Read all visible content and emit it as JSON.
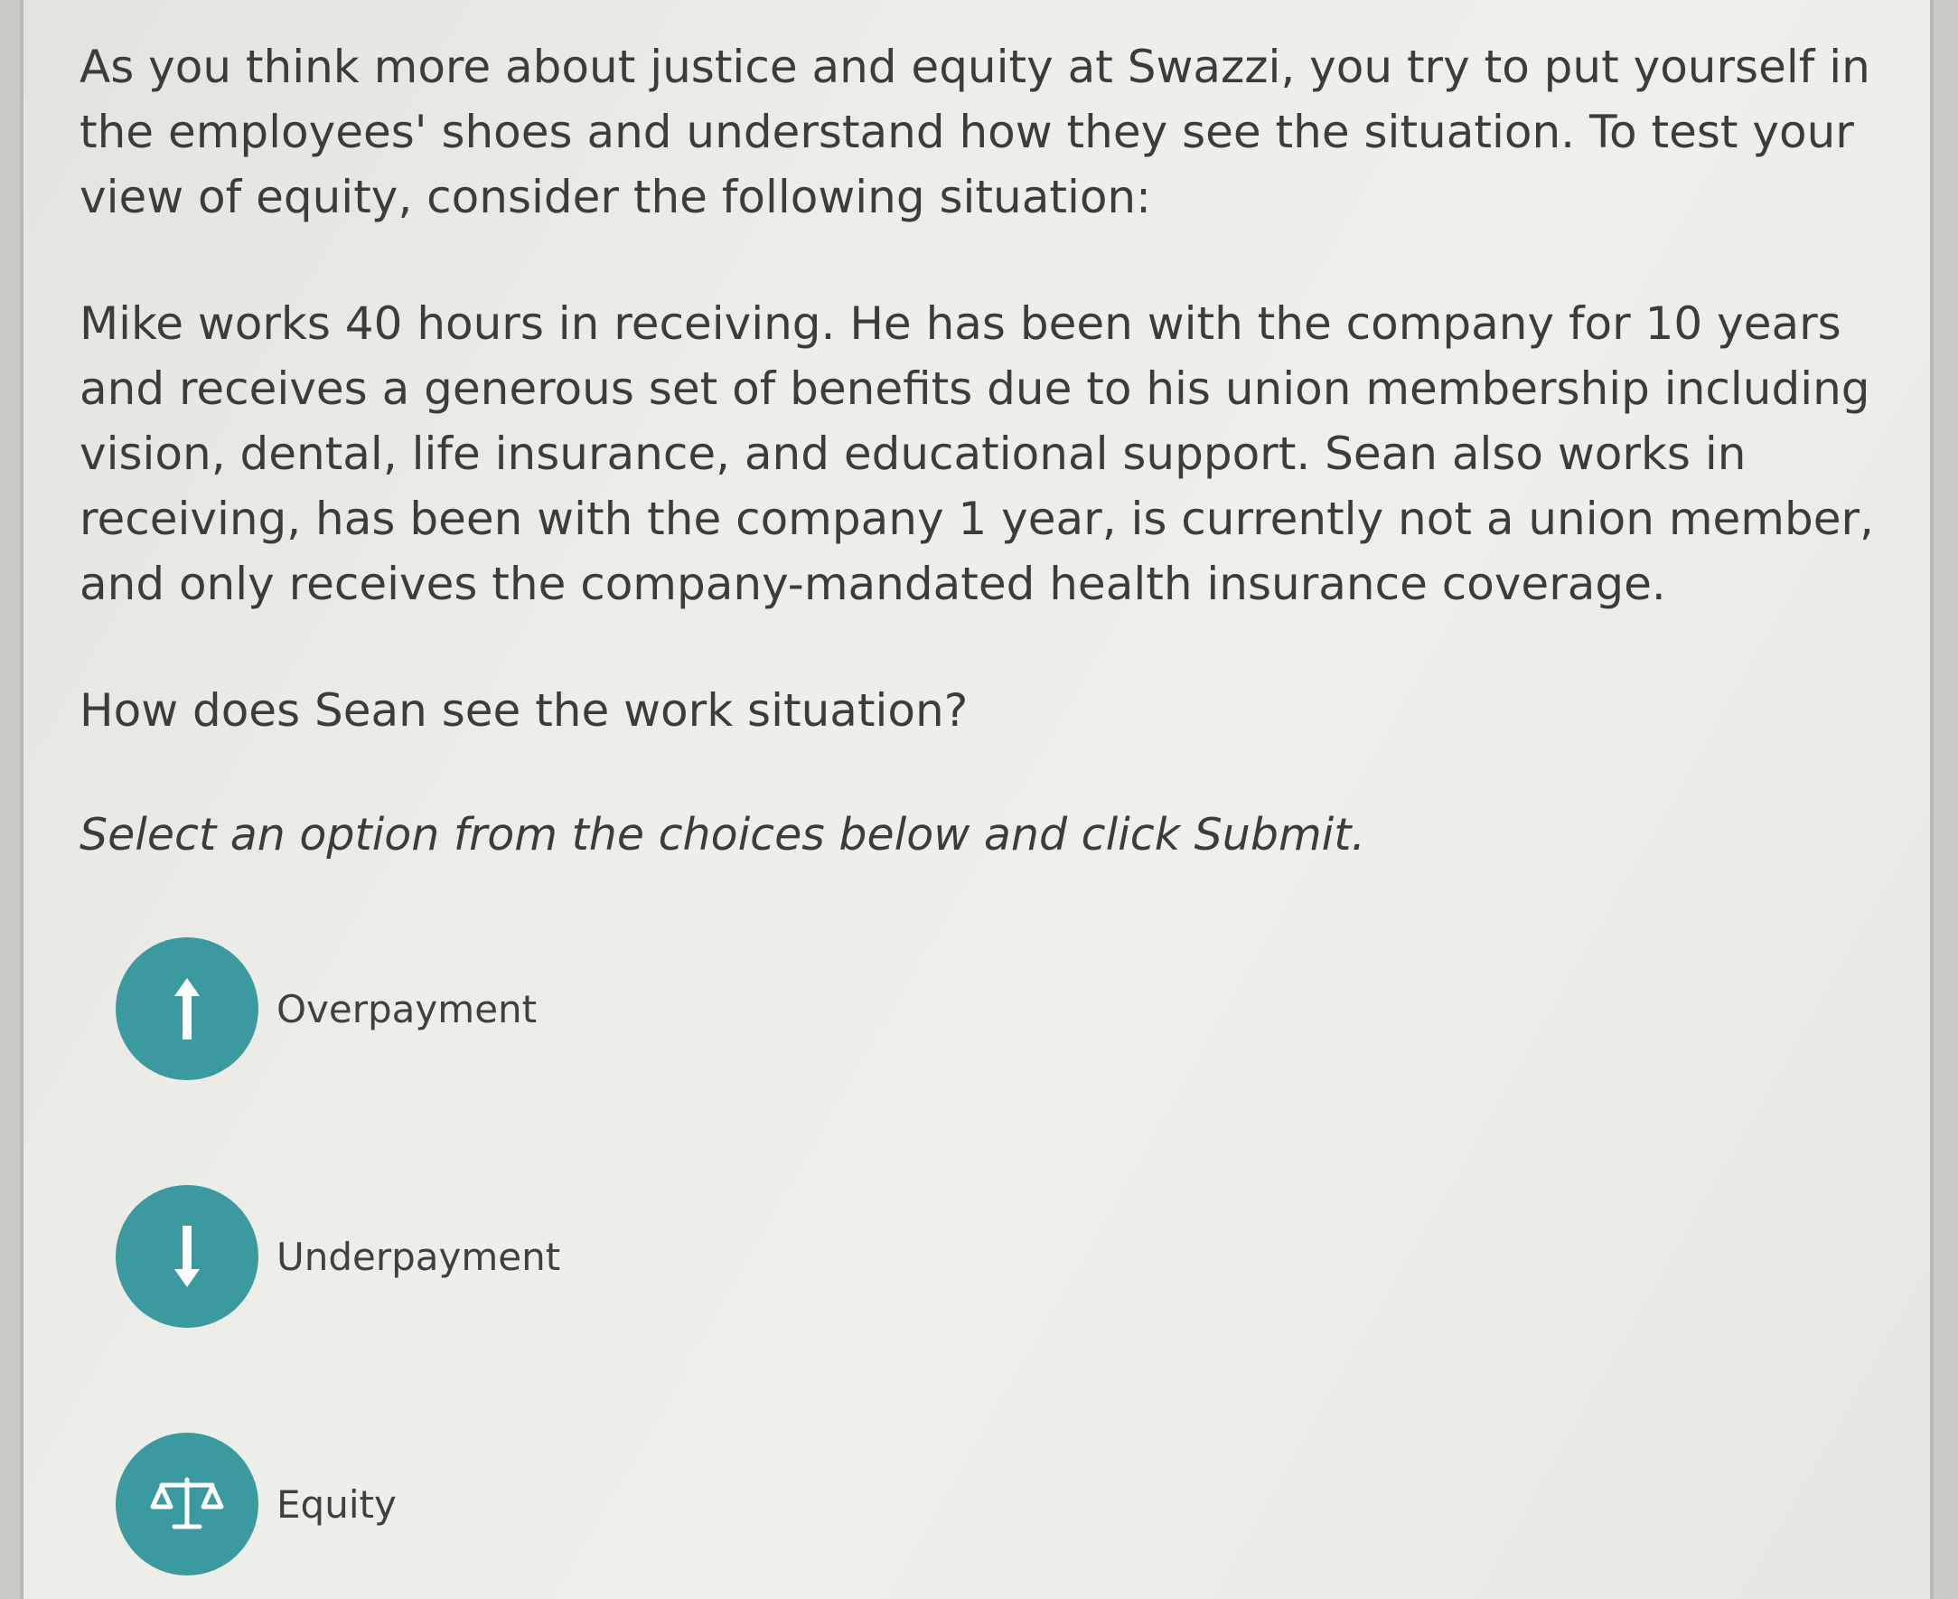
{
  "question": {
    "intro": "As you think more about justice and equity at Swazzi, you try to put yourself in the employees' shoes and understand how they see the situation. To test your view of equity, consider the following situation:",
    "scenario": "Mike works 40 hours in receiving. He has been with the company for 10 years and receives a generous set of benefits due to his union membership including vision, dental, life insurance, and educational support. Sean also works in receiving, has been with the company 1 year, is currently not a union member, and only receives the company-mandated health insurance coverage.",
    "prompt": "How does Sean see the work situation?",
    "instruction": "Select an option from the choices below and click Submit."
  },
  "options": [
    {
      "label": "Overpayment",
      "icon": "arrow-up-icon"
    },
    {
      "label": "Underpayment",
      "icon": "arrow-down-icon"
    },
    {
      "label": "Equity",
      "icon": "balance-scale-icon"
    }
  ],
  "colors": {
    "option_circle": "#3a9aa0",
    "text": "#3c3c3c"
  }
}
